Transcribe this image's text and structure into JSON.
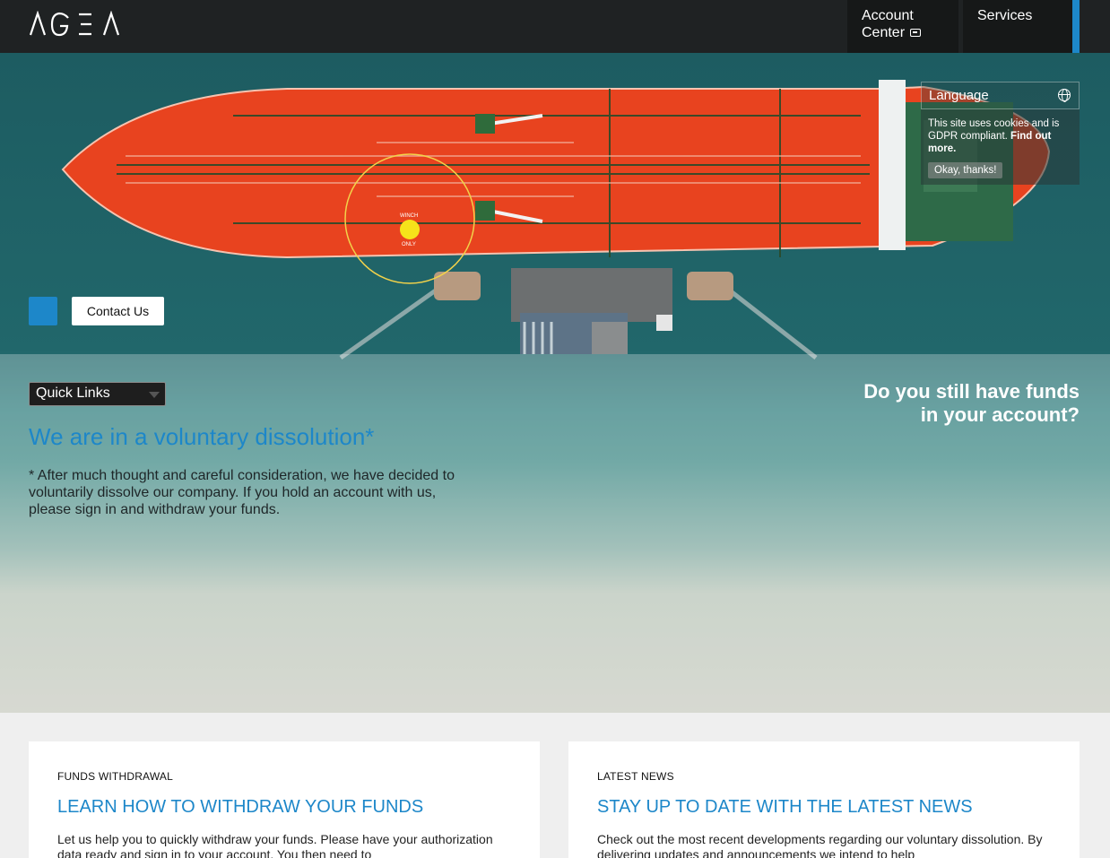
{
  "header": {
    "logo_text": "AGEA",
    "nav": {
      "account_center_line1": "Account",
      "account_center_line2": "Center",
      "services": "Services"
    }
  },
  "hero": {
    "contact_button": "Contact Us",
    "language_label": "Language",
    "cookie": {
      "text": "This site uses cookies and is GDPR compliant.",
      "link": "Find out more.",
      "button": "Okay, thanks!"
    },
    "ship_markings": {
      "winch": "WINCH",
      "only": "ONLY"
    },
    "quick_links_label": "Quick Links",
    "dissolution_title": "We are in a voluntary dissolution*",
    "dissolution_text": "* After much thought and careful consideration, we have decided to voluntarily dissolve our company. If you hold an account with us, please sign in and withdraw your funds.",
    "funds_question_line1": "Do you still have funds",
    "funds_question_line2": "in your account?"
  },
  "cards": [
    {
      "kicker": "FUNDS WITHDRAWAL",
      "title": "LEARN HOW TO WITHDRAW YOUR FUNDS",
      "text": "Let us help you to quickly withdraw your funds. Please have your authorization data ready and sign in to your account. You then need to"
    },
    {
      "kicker": "LATEST NEWS",
      "title": "STAY UP TO DATE WITH THE LATEST NEWS",
      "text": "Check out the most recent developments regarding our voluntary dissolution. By delivering updates and announcements we intend to help"
    }
  ],
  "colors": {
    "accent": "#1d87c9",
    "header_bg": "#1f2223",
    "ship_hull": "#e8431f"
  }
}
